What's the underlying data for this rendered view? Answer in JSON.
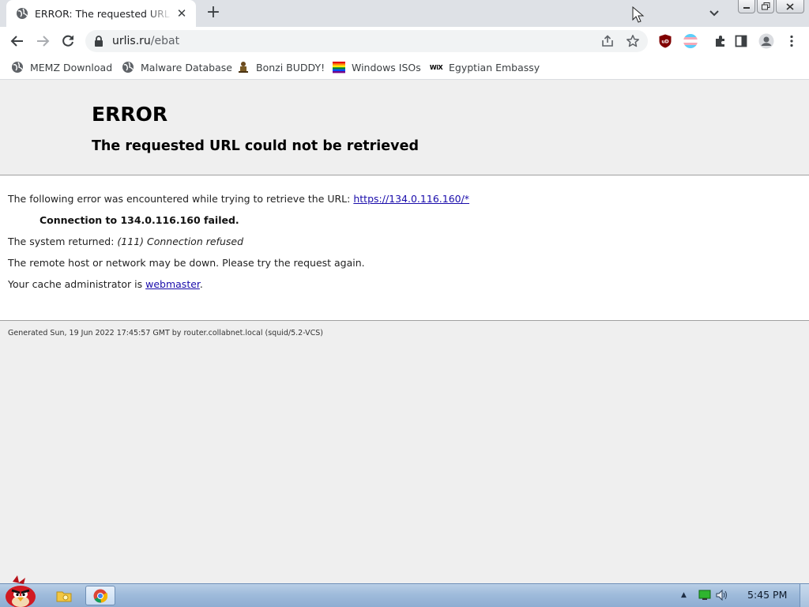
{
  "tab": {
    "title": "ERROR: The requested URL could not be retrieved",
    "close_glyph": "✕"
  },
  "new_tab_glyph": "+",
  "address": {
    "host": "urlis.ru",
    "path": "/ebat"
  },
  "bookmarks": [
    {
      "label": "MEMZ Download",
      "icon": "globe-icon"
    },
    {
      "label": "Malware Database",
      "icon": "globe-icon"
    },
    {
      "label": "Bonzi BUDDY!",
      "icon": "bonzi-icon"
    },
    {
      "label": "Windows ISOs",
      "icon": "rainbow-flag-icon"
    },
    {
      "label": "Egyptian Embassy",
      "icon": "wix-icon",
      "icon_text": "WiX"
    }
  ],
  "page": {
    "title": "ERROR",
    "subtitle": "The requested URL could not be retrieved",
    "intro": "The following error was encountered while trying to retrieve the URL: ",
    "link_url": "https://134.0.116.160/*",
    "connection_failed": "Connection to 134.0.116.160 failed.",
    "system_returned_label": "The system returned: ",
    "system_returned_value": "(111) Connection refused",
    "remote_down": "The remote host or network may be down. Please try the request again.",
    "cache_admin_prefix": "Your cache administrator is ",
    "cache_admin_link": "webmaster",
    "cache_admin_suffix": ".",
    "generated": "Generated Sun, 19 Jun 2022 17:45:57 GMT by router.collabnet.local (squid/5.2-VCS)"
  },
  "extensions": {
    "ublock_text": "uD"
  },
  "taskbar": {
    "clock": "5:45 PM"
  },
  "colors": {
    "accent_link": "#1a0dab",
    "tab_strip": "#dee1e6",
    "page_bg": "#efefef"
  }
}
